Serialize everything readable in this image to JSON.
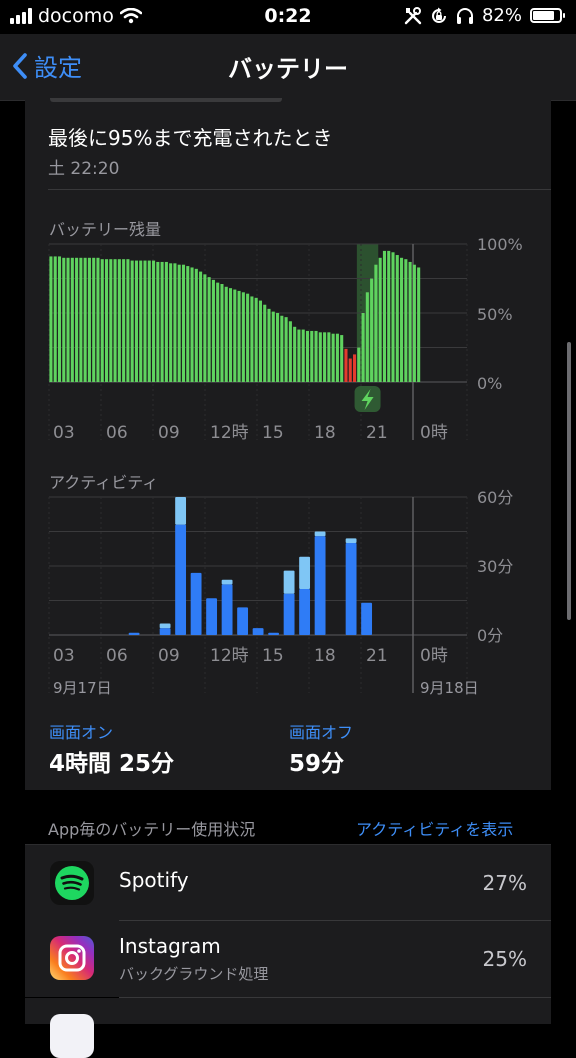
{
  "status": {
    "carrier": "docomo",
    "time": "0:22",
    "battery_pct": "82%",
    "battery_level": 0.82
  },
  "nav": {
    "back_label": "設定",
    "title": "バッテリー"
  },
  "last_charge": {
    "title": "最後に95%まで充電されたとき",
    "subtitle": "土 22:20"
  },
  "battery_chart_title": "バッテリー残量",
  "activity_chart_title": "アクティビティ",
  "date_labels": [
    "9月17日",
    "9月18日"
  ],
  "screen_on": {
    "label": "画面オン",
    "value": "4時間 25分"
  },
  "screen_off": {
    "label": "画面オフ",
    "value": "59分"
  },
  "app_usage": {
    "header": "App毎のバッテリー使用状況",
    "link": "アクティビティを表示",
    "apps": [
      {
        "name": "Spotify",
        "subtitle": "",
        "percent": "27%",
        "icon": "spotify-icon",
        "color": "#1ed760"
      },
      {
        "name": "Instagram",
        "subtitle": "バックグラウンド処理",
        "percent": "25%",
        "icon": "instagram-icon",
        "color": "#e1306c"
      }
    ]
  },
  "colors": {
    "accent": "#3e8ef7",
    "battery_green": "#5fd35f",
    "battery_red": "#e33b2e",
    "activity_blue": "#2f7cf6",
    "activity_light": "#7fc6f5",
    "charging_bg": "#2f5a33"
  },
  "chart_data": [
    {
      "type": "bar",
      "title": "バッテリー残量",
      "x_tick_labels": [
        "03",
        "06",
        "09",
        "12時",
        "15",
        "18",
        "21",
        "0時"
      ],
      "y_tick_labels": [
        "100%",
        "50%",
        "0%"
      ],
      "ylim": [
        0,
        100
      ],
      "bar_interval_minutes": 15,
      "charging_window_bars": [
        72,
        76
      ],
      "low_battery_bars": [
        69,
        70,
        71
      ],
      "values": [
        91,
        91,
        91,
        90,
        90,
        90,
        90,
        90,
        90,
        90,
        90,
        90,
        89,
        89,
        89,
        89,
        89,
        89,
        89,
        88,
        88,
        88,
        88,
        88,
        88,
        87,
        87,
        87,
        86,
        86,
        85,
        85,
        84,
        83,
        82,
        80,
        78,
        76,
        74,
        72,
        71,
        69,
        68,
        67,
        66,
        65,
        64,
        62,
        61,
        59,
        56,
        53,
        51,
        50,
        48,
        47,
        44,
        40,
        38,
        38,
        37,
        37,
        37,
        36,
        36,
        36,
        35,
        35,
        34,
        24,
        17,
        20,
        25,
        50,
        65,
        75,
        85,
        90,
        95,
        95,
        94,
        92,
        90,
        89,
        87,
        85,
        83
      ]
    },
    {
      "type": "bar",
      "title": "アクティビティ",
      "x_tick_labels": [
        "03",
        "06",
        "09",
        "12時",
        "15",
        "18",
        "21",
        "0時"
      ],
      "y_tick_labels": [
        "60分",
        "30分",
        "0分"
      ],
      "ylim": [
        0,
        60
      ],
      "bar_interval_minutes": 60,
      "series": [
        {
          "name": "画面オン",
          "values": [
            0,
            0,
            0,
            0,
            0,
            1,
            0,
            3,
            48,
            27,
            16,
            22,
            12,
            3,
            1,
            18,
            20,
            43,
            0,
            40,
            14,
            0,
            0,
            0
          ]
        },
        {
          "name": "画面オフ",
          "values": [
            0,
            0,
            0,
            0,
            0,
            0,
            0,
            2,
            12,
            0,
            0,
            2,
            0,
            0,
            0,
            10,
            14,
            2,
            0,
            2,
            0,
            0,
            0,
            0
          ]
        }
      ]
    }
  ]
}
